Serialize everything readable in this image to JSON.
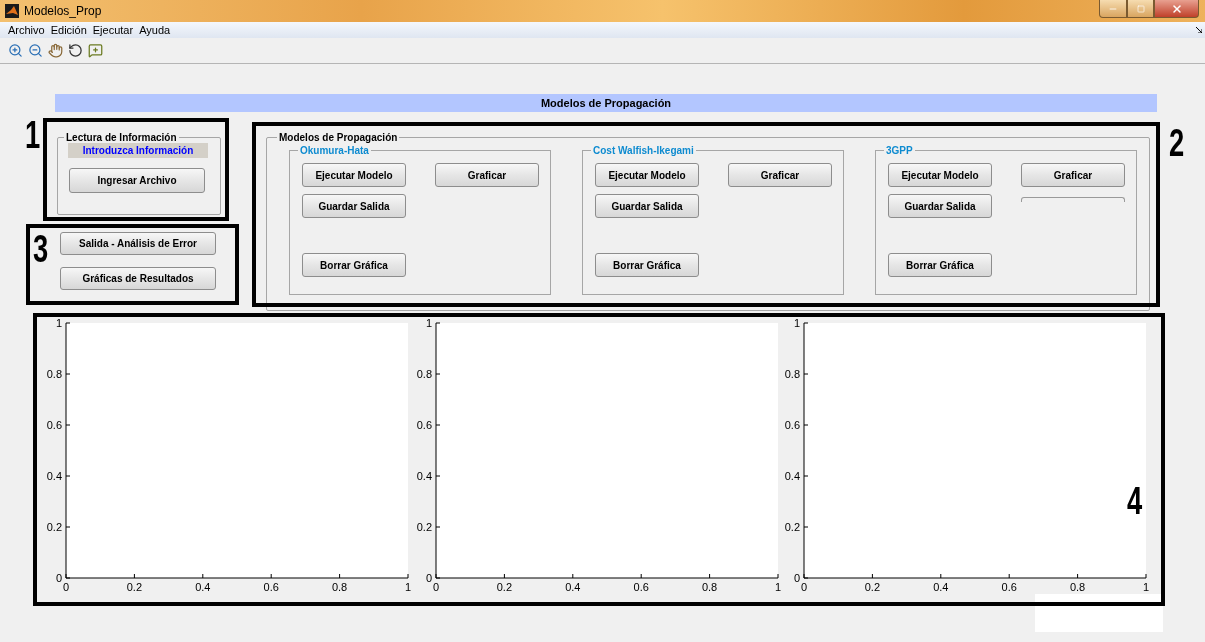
{
  "window": {
    "title": "Modelos_Prop"
  },
  "menu": [
    "Archivo",
    "Edición",
    "Ejecutar",
    "Ayuda"
  ],
  "toolbar": [
    {
      "kind": "zoom_in"
    },
    {
      "kind": "zoom_out"
    },
    {
      "kind": "pan"
    },
    {
      "kind": "rotate"
    },
    {
      "kind": "data_cursor"
    }
  ],
  "header": "Modelos de Propagación",
  "lectura": {
    "title": "Lectura de Información",
    "status": "Introduzca Información",
    "button": "Ingresar Archivo"
  },
  "side_buttons": [
    "Salida - Análisis de Error",
    "Gráficas de Resultados"
  ],
  "models": {
    "title": "Modelos de Propagación",
    "panels": [
      {
        "title": "Okumura-Hata",
        "run": "Ejecutar Modelo",
        "plot": "Graficar",
        "save": "Guardar Salida",
        "clear": "Borrar Gráfica",
        "partial_button": false
      },
      {
        "title": "Cost Walfish-Ikegami",
        "run": "Ejecutar Modelo",
        "plot": "Graficar",
        "save": "Guardar Salida",
        "clear": "Borrar Gráfica",
        "partial_button": false
      },
      {
        "title": "3GPP",
        "run": "Ejecutar Modelo",
        "plot": "Graficar",
        "save": "Guardar Salida",
        "clear": "Borrar Gráfica",
        "partial_button": true
      }
    ]
  },
  "plots": [
    {
      "chart_data": {
        "type": "line",
        "xlim": [
          0,
          1
        ],
        "ylim": [
          0,
          1
        ],
        "xticks": [
          0,
          0.2,
          0.4,
          0.6,
          0.8,
          1
        ],
        "yticks": [
          0,
          0.2,
          0.4,
          0.6,
          0.8,
          1
        ]
      }
    },
    {
      "chart_data": {
        "type": "line",
        "xlim": [
          0,
          1
        ],
        "ylim": [
          0,
          1
        ],
        "xticks": [
          0,
          0.2,
          0.4,
          0.6,
          0.8,
          1
        ],
        "yticks": [
          0,
          0.2,
          0.4,
          0.6,
          0.8,
          1
        ]
      }
    },
    {
      "chart_data": {
        "type": "line",
        "xlim": [
          0,
          1
        ],
        "ylim": [
          0,
          1
        ],
        "xticks": [
          0,
          0.2,
          0.4,
          0.6,
          0.8,
          1
        ],
        "yticks": [
          0,
          0.2,
          0.4,
          0.6,
          0.8,
          1
        ]
      }
    }
  ],
  "annotations": [
    {
      "label": "1"
    },
    {
      "label": "2"
    },
    {
      "label": "3"
    },
    {
      "label": "4"
    }
  ]
}
